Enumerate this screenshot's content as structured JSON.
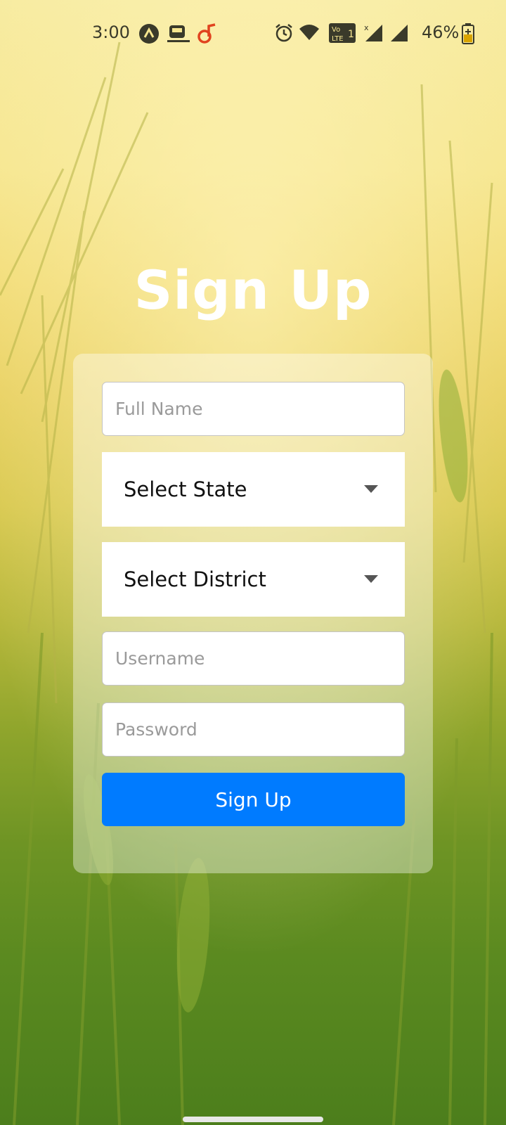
{
  "status_bar": {
    "time": "3:00",
    "battery_percent": "46%",
    "left_icons": [
      "app-a-icon",
      "train-icon",
      "music-note-icon"
    ],
    "right_icons": [
      "alarm-icon",
      "wifi-icon",
      "volte-icon",
      "signal-x-icon",
      "signal-icon",
      "battery-charging-icon"
    ]
  },
  "page": {
    "title": "Sign Up"
  },
  "form": {
    "full_name_placeholder": "Full Name",
    "state_select": "Select State",
    "district_select": "Select District",
    "username_placeholder": "Username",
    "password_placeholder": "Password",
    "submit_label": "Sign Up"
  },
  "colors": {
    "accent": "#007bff",
    "title": "#ffffff",
    "background_top": "#f7eba0",
    "background_bottom": "#4c7e1c"
  }
}
